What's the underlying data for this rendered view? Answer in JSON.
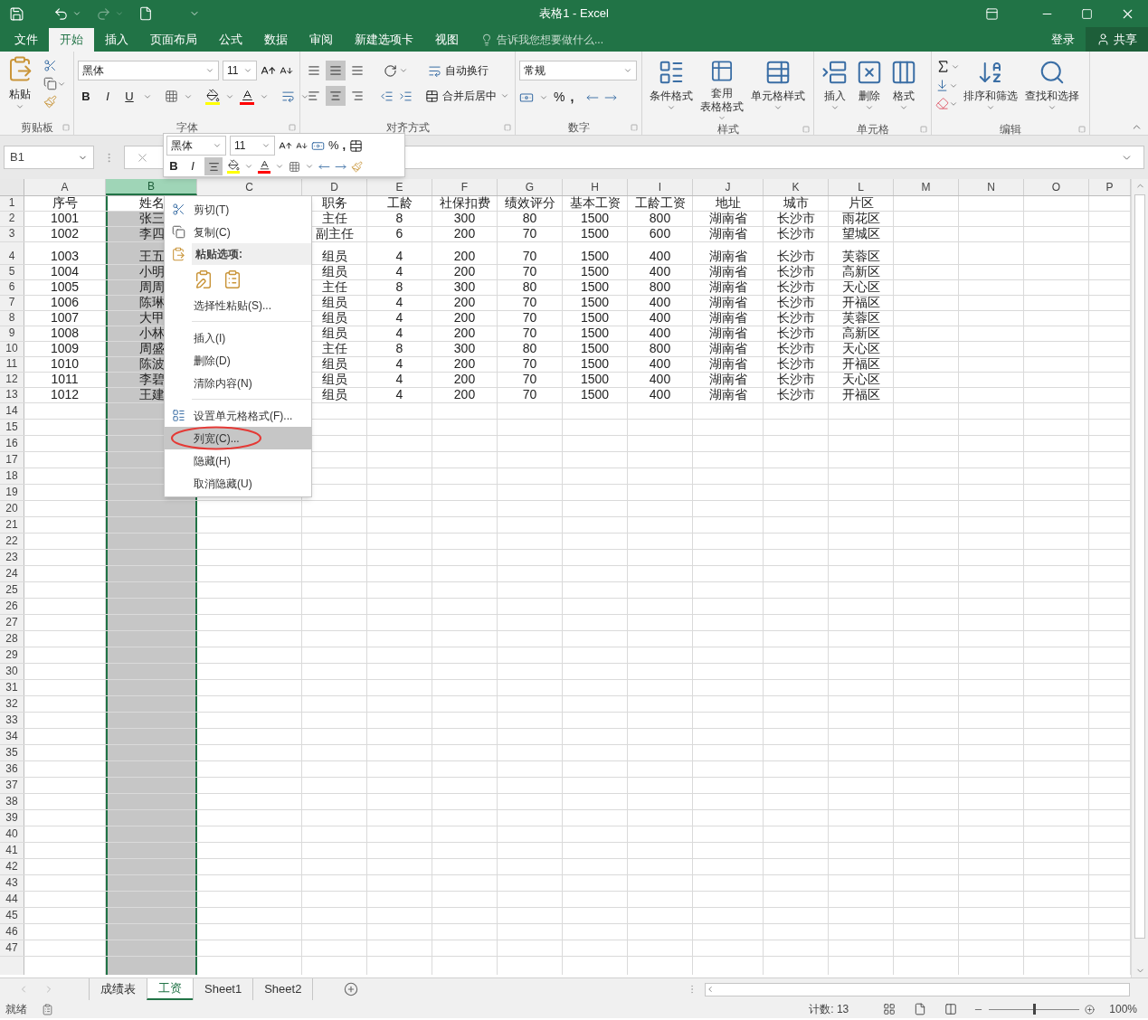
{
  "window": {
    "title": "表格1 - Excel",
    "redo_disabled": true
  },
  "ribbon_tabs": [
    {
      "label": "文件",
      "selected": false
    },
    {
      "label": "开始",
      "selected": true
    },
    {
      "label": "插入",
      "selected": false
    },
    {
      "label": "页面布局",
      "selected": false
    },
    {
      "label": "公式",
      "selected": false
    },
    {
      "label": "数据",
      "selected": false
    },
    {
      "label": "审阅",
      "selected": false
    },
    {
      "label": "新建选项卡",
      "selected": false
    },
    {
      "label": "视图",
      "selected": false
    }
  ],
  "tell_me": {
    "placeholder": "告诉我您想要做什么..."
  },
  "account": {
    "sign_in": "登录",
    "share": "共享"
  },
  "ribbon": {
    "clipboard": {
      "label": "剪贴板",
      "paste": "粘贴"
    },
    "font": {
      "label": "字体",
      "font_name": "黑体",
      "font_size": "11",
      "bold": "B",
      "italic": "I",
      "underline": "U"
    },
    "alignment": {
      "label": "对齐方式",
      "wrap_text": "自动换行",
      "merge_center": "合并后居中",
      "vertical_align": [
        {
          "selected": false
        },
        {
          "selected": true
        },
        {
          "selected": false
        }
      ],
      "horizontal_align": [
        {
          "selected": false
        },
        {
          "selected": true
        },
        {
          "selected": false
        }
      ]
    },
    "number": {
      "label": "数字",
      "format": "常规",
      "percent": "%",
      "comma": ","
    },
    "styles": {
      "label": "样式",
      "buttons": [
        {
          "lines": [
            "条件格式"
          ]
        },
        {
          "lines": [
            "套用",
            "表格格式"
          ]
        },
        {
          "lines": [
            "单元格样式"
          ]
        }
      ]
    },
    "cells": {
      "label": "单元格",
      "buttons": [
        "插入",
        "删除",
        "格式"
      ]
    },
    "editing": {
      "label": "编辑",
      "buttons": [
        "排序和筛选",
        "查找和选择"
      ]
    }
  },
  "formula_bar": {
    "name_box": "B1"
  },
  "mini_toolbar": {
    "font_name": "黑体",
    "font_size": "11",
    "percent": "%",
    "comma": ",",
    "bold": "B",
    "italic": "I",
    "center_selected": true
  },
  "context_menu": {
    "items": [
      {
        "kind": "item",
        "label": "剪切(T)",
        "selected": false,
        "circled": false
      },
      {
        "kind": "item",
        "label": "复制(C)",
        "selected": false,
        "circled": false
      },
      {
        "kind": "header",
        "label": "粘贴选项:"
      },
      {
        "kind": "paste_options"
      },
      {
        "kind": "item",
        "label": "选择性粘贴(S)...",
        "selected": false,
        "circled": false
      },
      {
        "kind": "separator"
      },
      {
        "kind": "item",
        "label": "插入(I)",
        "selected": false,
        "circled": false
      },
      {
        "kind": "item",
        "label": "删除(D)",
        "selected": false,
        "circled": false
      },
      {
        "kind": "item",
        "label": "清除内容(N)",
        "selected": false,
        "circled": false
      },
      {
        "kind": "separator"
      },
      {
        "kind": "item",
        "label": "设置单元格格式(F)...",
        "selected": false,
        "circled": false
      },
      {
        "kind": "item",
        "label": "列宽(C)...",
        "selected": true,
        "circled": true
      },
      {
        "kind": "item",
        "label": "隐藏(H)",
        "selected": false,
        "circled": false
      },
      {
        "kind": "item",
        "label": "取消隐藏(U)",
        "selected": false,
        "circled": false
      }
    ]
  },
  "sheet": {
    "columns": [
      {
        "letter": "A",
        "selected": false
      },
      {
        "letter": "B",
        "selected": true
      },
      {
        "letter": "C",
        "selected": false
      },
      {
        "letter": "D",
        "selected": false
      },
      {
        "letter": "E",
        "selected": false
      },
      {
        "letter": "F",
        "selected": false
      },
      {
        "letter": "G",
        "selected": false
      },
      {
        "letter": "H",
        "selected": false
      },
      {
        "letter": "I",
        "selected": false
      },
      {
        "letter": "J",
        "selected": false
      },
      {
        "letter": "K",
        "selected": false
      },
      {
        "letter": "L",
        "selected": false
      },
      {
        "letter": "M",
        "selected": false
      },
      {
        "letter": "N",
        "selected": false
      },
      {
        "letter": "O",
        "selected": false
      },
      {
        "letter": "P",
        "selected": false
      }
    ],
    "rows": [
      {
        "number": "1",
        "cells": {
          "A": "序号",
          "B": "姓名",
          "D": "职务",
          "E": "工龄",
          "F": "社保扣费",
          "G": "绩效评分",
          "H": "基本工资",
          "I": "工龄工资",
          "J": "地址",
          "K": "城市",
          "L": "片区"
        }
      },
      {
        "number": "2",
        "cells": {
          "A": "1001",
          "B": "张三",
          "D": "主任",
          "E": "8",
          "F": "300",
          "G": "80",
          "H": "1500",
          "I": "800",
          "J": "湖南省",
          "K": "长沙市",
          "L": "雨花区"
        }
      },
      {
        "number": "3",
        "cells": {
          "A": "1002",
          "B": "李四",
          "D": "副主任",
          "E": "6",
          "F": "200",
          "G": "70",
          "H": "1500",
          "I": "600",
          "J": "湖南省",
          "K": "长沙市",
          "L": "望城区"
        }
      },
      {
        "number": "4",
        "tall": true,
        "cells": {
          "A": "1003",
          "B": "王五",
          "D": "组员",
          "E": "4",
          "F": "200",
          "G": "70",
          "H": "1500",
          "I": "400",
          "J": "湖南省",
          "K": "长沙市",
          "L": "芙蓉区"
        }
      },
      {
        "number": "5",
        "cells": {
          "A": "1004",
          "B": "小明",
          "D": "组员",
          "E": "4",
          "F": "200",
          "G": "70",
          "H": "1500",
          "I": "400",
          "J": "湖南省",
          "K": "长沙市",
          "L": "高新区"
        }
      },
      {
        "number": "6",
        "cells": {
          "A": "1005",
          "B": "周周",
          "D": "主任",
          "E": "8",
          "F": "300",
          "G": "80",
          "H": "1500",
          "I": "800",
          "J": "湖南省",
          "K": "长沙市",
          "L": "天心区"
        }
      },
      {
        "number": "7",
        "cells": {
          "A": "1006",
          "B": "陈琳",
          "D": "组员",
          "E": "4",
          "F": "200",
          "G": "70",
          "H": "1500",
          "I": "400",
          "J": "湖南省",
          "K": "长沙市",
          "L": "开福区"
        }
      },
      {
        "number": "8",
        "cells": {
          "A": "1007",
          "B": "大甲",
          "D": "组员",
          "E": "4",
          "F": "200",
          "G": "70",
          "H": "1500",
          "I": "400",
          "J": "湖南省",
          "K": "长沙市",
          "L": "芙蓉区"
        }
      },
      {
        "number": "9",
        "cells": {
          "A": "1008",
          "B": "小林",
          "D": "组员",
          "E": "4",
          "F": "200",
          "G": "70",
          "H": "1500",
          "I": "400",
          "J": "湖南省",
          "K": "长沙市",
          "L": "高新区"
        }
      },
      {
        "number": "10",
        "cells": {
          "A": "1009",
          "B": "周盛",
          "D": "主任",
          "E": "8",
          "F": "300",
          "G": "80",
          "H": "1500",
          "I": "800",
          "J": "湖南省",
          "K": "长沙市",
          "L": "天心区"
        }
      },
      {
        "number": "11",
        "cells": {
          "A": "1010",
          "B": "陈波",
          "D": "组员",
          "E": "4",
          "F": "200",
          "G": "70",
          "H": "1500",
          "I": "400",
          "J": "湖南省",
          "K": "长沙市",
          "L": "开福区"
        }
      },
      {
        "number": "12",
        "cells": {
          "A": "1011",
          "B": "李碧",
          "D": "组员",
          "E": "4",
          "F": "200",
          "G": "70",
          "H": "1500",
          "I": "400",
          "J": "湖南省",
          "K": "长沙市",
          "L": "天心区"
        }
      },
      {
        "number": "13",
        "cells": {
          "A": "1012",
          "B": "王建",
          "D": "组员",
          "E": "4",
          "F": "200",
          "G": "70",
          "H": "1500",
          "I": "400",
          "J": "湖南省",
          "K": "长沙市",
          "L": "开福区"
        }
      }
    ],
    "empty_rows": [
      "14",
      "15",
      "16",
      "17",
      "18",
      "19",
      "20",
      "21",
      "22",
      "23",
      "24",
      "25",
      "26",
      "27",
      "28",
      "29",
      "30",
      "31",
      "32",
      "33",
      "34",
      "35",
      "36",
      "37",
      "38",
      "39",
      "40",
      "41",
      "42",
      "43",
      "44",
      "45",
      "46",
      "47"
    ]
  },
  "sheet_tabs": [
    {
      "label": "成绩表",
      "selected": false
    },
    {
      "label": "工资",
      "selected": true
    },
    {
      "label": "Sheet1",
      "selected": false
    },
    {
      "label": "Sheet2",
      "selected": false
    }
  ],
  "status_bar": {
    "status": "就绪",
    "count": "计数: 13",
    "zoom": "100%",
    "zoom_level": {
      "level": 0.5
    }
  }
}
